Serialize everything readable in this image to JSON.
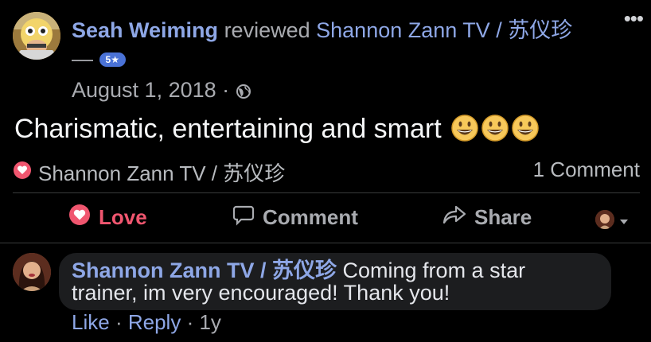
{
  "post": {
    "author_name": "Seah Weiming",
    "verb": "reviewed",
    "page_name": "Shannon Zann TV / 苏仪珍",
    "dash": "—",
    "rating_badge": "5★",
    "date": "August 1, 2018",
    "dot": "·",
    "privacy_icon": "globe-icon",
    "text": "Charismatic, entertaining and smart",
    "emoji_icon": "grinning-face-icon",
    "more_icon": "•••"
  },
  "stats": {
    "reaction_icon": "heart-icon",
    "reactor_name": "Shannon Zann TV / 苏仪珍",
    "comment_count": "1 Comment"
  },
  "actions": {
    "love_label": "Love",
    "comment_label": "Comment",
    "share_label": "Share"
  },
  "comment": {
    "author_name": "Shannon Zann TV / 苏仪珍",
    "text": "Coming from a star trainer, im very encouraged! Thank you!",
    "like_label": "Like",
    "reply_label": "Reply",
    "time": "1y",
    "sep": "·"
  },
  "colors": {
    "background": "#000000",
    "link": "#8ea7e6",
    "love": "#f0566f",
    "badge": "#4a72d6"
  }
}
